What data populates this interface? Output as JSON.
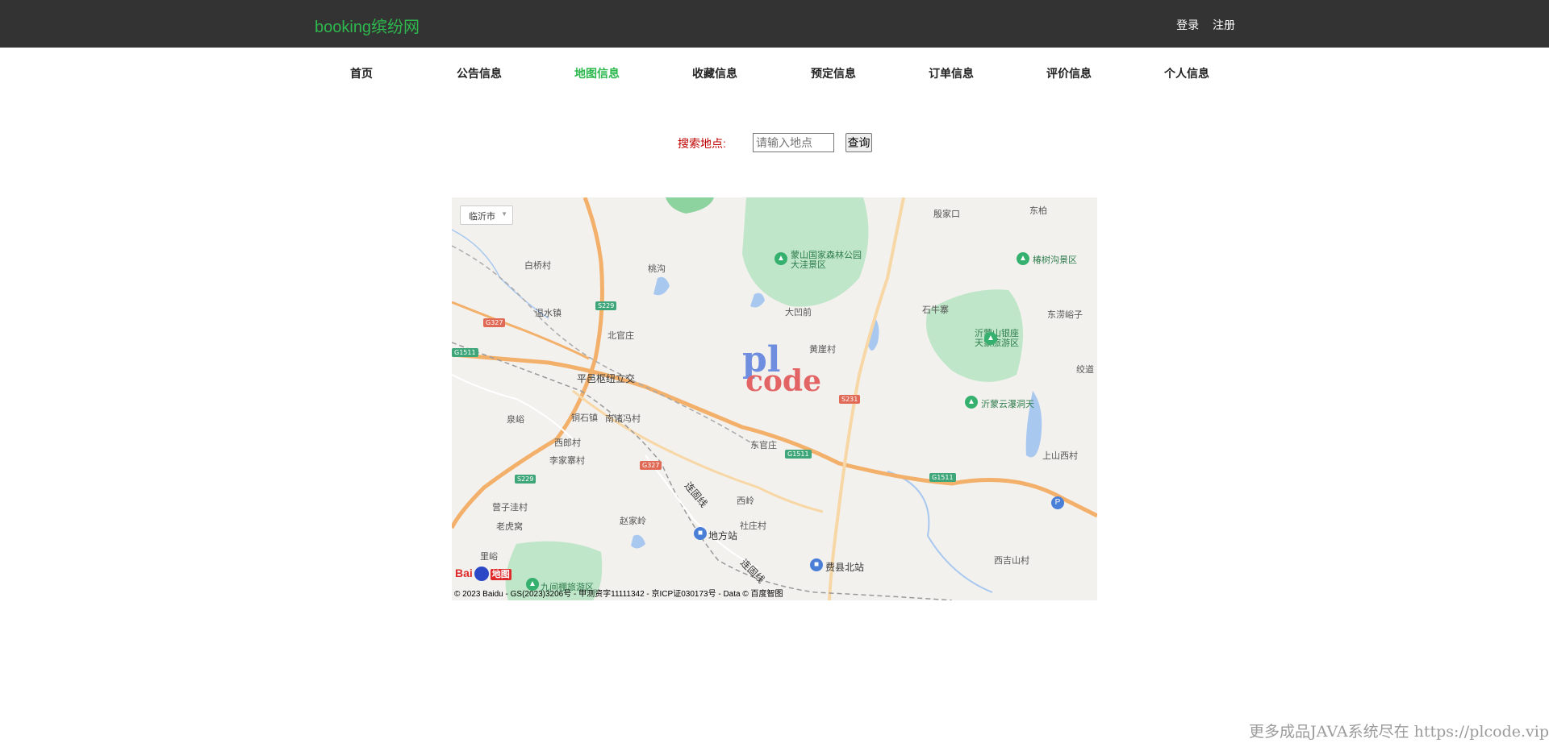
{
  "header": {
    "brand": "booking缤纷网",
    "login_label": "登录",
    "register_label": "注册"
  },
  "nav": {
    "items": [
      {
        "label": "首页"
      },
      {
        "label": "公告信息"
      },
      {
        "label": "地图信息"
      },
      {
        "label": "收藏信息"
      },
      {
        "label": "预定信息"
      },
      {
        "label": "订单信息"
      },
      {
        "label": "评价信息"
      },
      {
        "label": "个人信息"
      }
    ],
    "active_index": 2
  },
  "search": {
    "label": "搜索地点:",
    "placeholder": "请输入地点",
    "value": "",
    "button_label": "查询"
  },
  "map": {
    "city_select": "临沂市",
    "labels": {
      "baijiacun": "白桥村",
      "taogou": "桃沟",
      "wenshuizhen": "温水镇",
      "beiguanzhuang": "北官庄",
      "pingyi_hub": "平邑枢纽立交",
      "quanyu": "泉峪",
      "tongshizhen": "铜石镇",
      "nanzhufeng": "南诸冯村",
      "xilangcun": "西郎村",
      "lijiazhaicun": "李家寨村",
      "yingzicun": "营子洼村",
      "laohuwo": "老虎窝",
      "liyu": "里峪",
      "zhaojialing": "赵家岭",
      "lianguxian1": "连固线",
      "lianguxian2": "连固线",
      "xiling": "西岭",
      "shezhuangcun": "社庄村",
      "difangzhan": "地方站",
      "feixianbeizhan": "费县北站",
      "dongguanzhuang": "东官庄",
      "huangyacun": "黄崖村",
      "dayaoqian": "大凹前",
      "mengshan_park": "蒙山国家森林公园\n大洼景区",
      "yinjiakou": "殷家口",
      "dongbai": "东柏",
      "chunshugou": "椿树沟景区",
      "shiniuzhai": "石牛寨",
      "dongliuyuzi": "东涝峪子",
      "yimengshan_yinzuo": "沂蒙山银座\n天蒙旅游区",
      "jiaodao": "绞道",
      "yimeng_yunpu": "沂蒙云瀑洞天",
      "shangshanxicun": "上山西村",
      "xijishancun": "西吉山村",
      "jiuzhen": "九间棚旅游区"
    },
    "shields": {
      "s229_a": "S229",
      "s229_b": "S229",
      "g327_a": "G327",
      "g327_b": "G327",
      "g1511_a": "G1511",
      "g1511_b": "G1511",
      "g1511_c": "G1511",
      "s231": "S231"
    },
    "watermark_top": "pl",
    "watermark_bottom": "code",
    "logo_text": "Bai",
    "logo_tag": "地图",
    "copyright": "© 2023 Baidu - GS(2023)3206号 - 甲测资字11111342 - 京ICP证030173号 - Data © 百度智图"
  },
  "footer_note": "更多成品JAVA系统尽在 https://plcode.vip",
  "colors": {
    "topbar": "#333333",
    "brand": "#2db84d",
    "nav_active": "#2db84d",
    "search_label": "#c00000"
  }
}
